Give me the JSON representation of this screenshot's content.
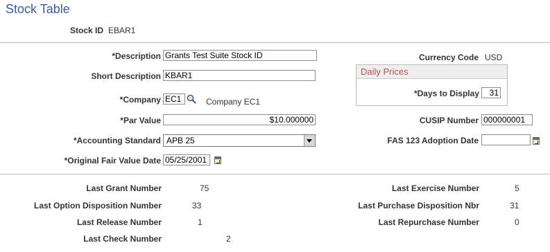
{
  "page": {
    "title": "Stock Table"
  },
  "header": {
    "stock_id_label": "Stock ID",
    "stock_id_value": "EBAR1"
  },
  "form": {
    "description_label": "*Description",
    "description_value": "Grants Test Suite Stock ID",
    "short_description_label": "Short Description",
    "short_description_value": "KBAR1",
    "company_label": "*Company",
    "company_value": "EC1",
    "company_name": "Company EC1",
    "par_value_label": "*Par Value",
    "par_value_value": "$10.000000",
    "accounting_standard_label": "*Accounting Standard",
    "accounting_standard_value": "APB 25",
    "original_fair_value_date_label": "*Original Fair Value Date",
    "original_fair_value_date_value": "05/25/2001",
    "currency_code_label": "Currency Code",
    "currency_code_value": "USD",
    "daily_prices_title": "Daily Prices",
    "days_to_display_label": "*Days to Display",
    "days_to_display_value": "31",
    "cusip_label": "CUSIP Number",
    "cusip_value": "000000001",
    "fas123_label": "FAS 123 Adoption Date",
    "fas123_value": ""
  },
  "numbers": {
    "last_grant_label": "Last Grant Number",
    "last_grant_value": "75",
    "last_option_disp_label": "Last Option Disposition Number",
    "last_option_disp_value": "33",
    "last_release_label": "Last Release Number",
    "last_release_value": "1",
    "last_check_label": "Last Check Number",
    "last_check_value": "2",
    "last_exercise_label": "Last Exercise Number",
    "last_exercise_value": "5",
    "last_purchase_disp_label": "Last Purchase Disposition Nbr",
    "last_purchase_disp_value": "31",
    "last_repurchase_label": "Last Repurchase Number",
    "last_repurchase_value": "0"
  }
}
